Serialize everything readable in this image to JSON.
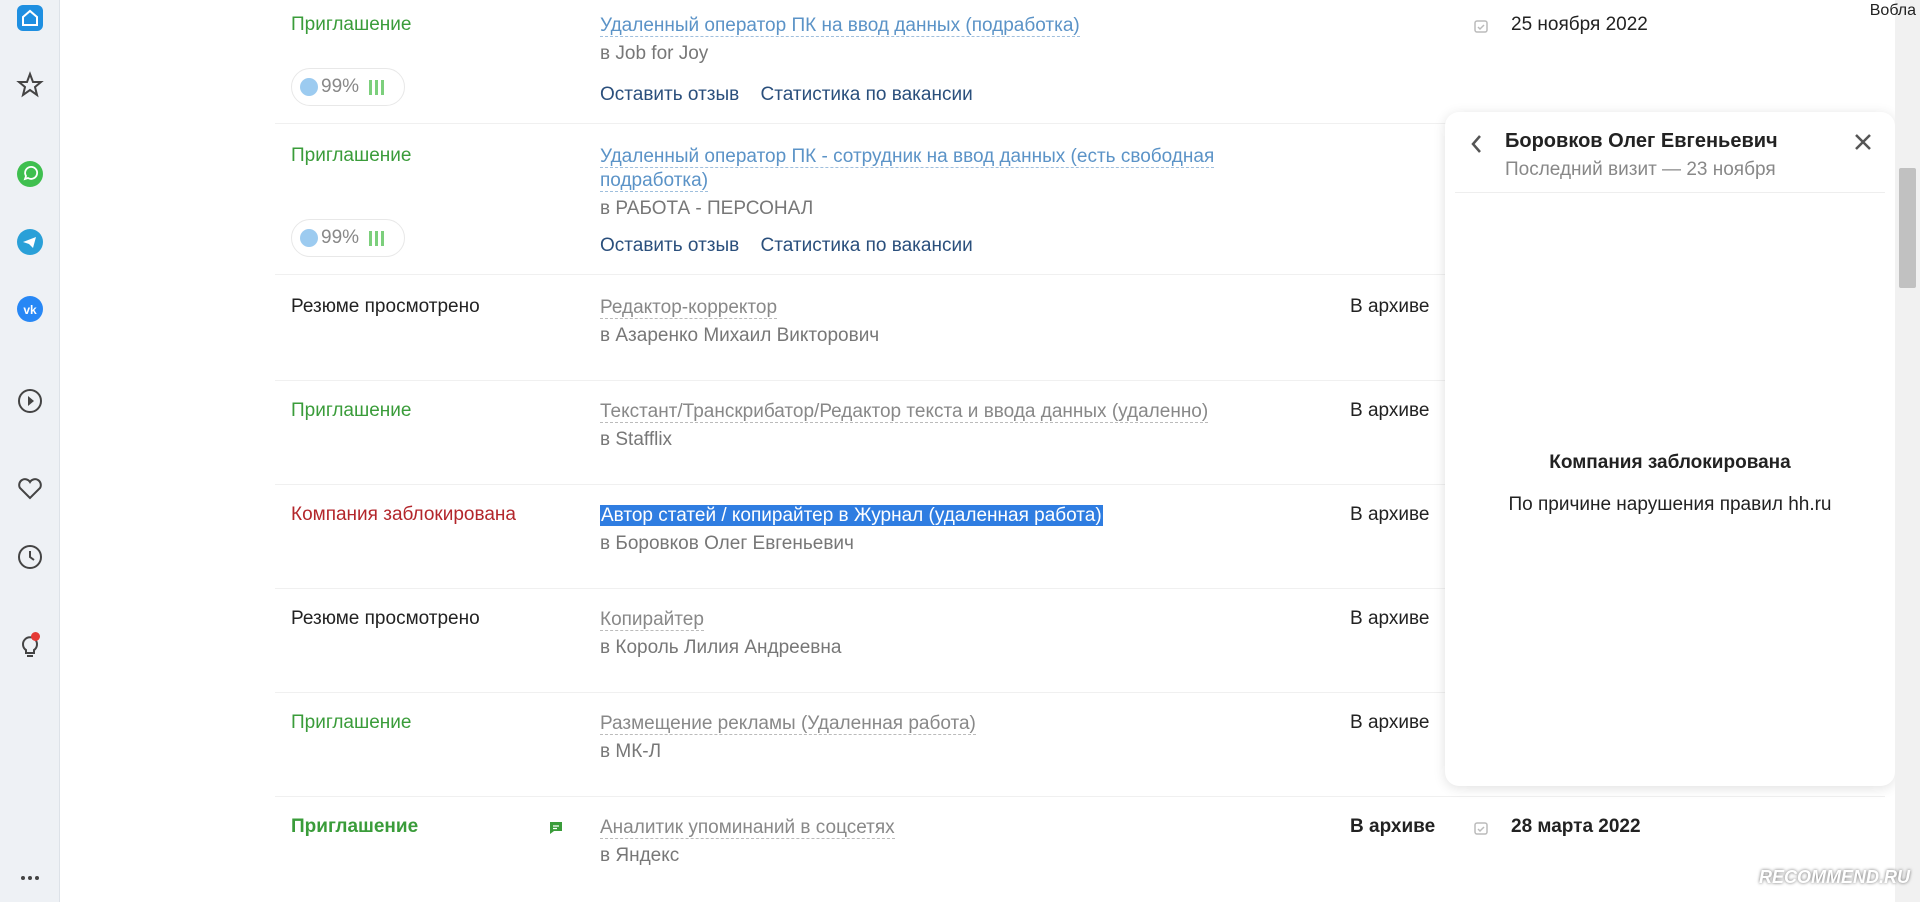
{
  "top_right_label": "Вобла",
  "sidebar": {
    "icons": [
      "home-icon",
      "star-icon",
      "whatsapp-icon",
      "telegram-icon",
      "vk-icon",
      "play-icon",
      "heart-icon",
      "clock-icon",
      "lightbulb-icon",
      "more-icon"
    ],
    "accent": "#1e8fe1"
  },
  "rows": [
    {
      "status": "Приглашение",
      "vacancy": "Удаленный оператор ПК на ввод данных (подработка)",
      "company": "в Job for Joy",
      "badge": "99%",
      "action_feedback": "Оставить отзыв",
      "action_stats": "Статистика по вакансии",
      "date": "25 ноября 2022"
    },
    {
      "status": "Приглашение",
      "vacancy": "Удаленный оператор ПК - сотрудник на ввод данных (есть свободная подработка)",
      "company": "в РАБОТА - ПЕРСОНАЛ",
      "badge": "99%",
      "action_feedback": "Оставить отзыв",
      "action_stats": "Статистика по вакансии"
    },
    {
      "status": "Резюме просмотрено",
      "vacancy": "Редактор-корректор",
      "company": "в Азаренко Михаил Викторович",
      "archive": "В архиве"
    },
    {
      "status": "Приглашение",
      "vacancy": "Текстант/Транскрибатор/Редактор текста и ввода данных (удаленно)",
      "company": "в Stafflix",
      "archive": "В архиве"
    },
    {
      "status": "Компания заблокирована",
      "vacancy": "Автор статей / копирайтер в Журнал (удаленная работа)",
      "company": "в Боровков Олег Евгеньевич",
      "archive": "В архиве"
    },
    {
      "status": "Резюме просмотрено",
      "vacancy": "Копирайтер",
      "company": "в Король Лилия Андреевна",
      "archive": "В архиве"
    },
    {
      "status": "Приглашение",
      "vacancy": "Размещение рекламы (Удаленная работа)",
      "company": "в МК-Л",
      "archive": "В архиве"
    },
    {
      "status": "Приглашение",
      "vacancy": "Аналитик упоминаний в соцсетях",
      "company": "в Яндекс",
      "archive": "В архиве",
      "date": "28 марта 2022"
    }
  ],
  "panel": {
    "name": "Боровков Олег Евгеньевич",
    "last_visit": "Последний визит — 23 ноября",
    "title": "Компания заблокирована",
    "text": "По причине нарушения правил hh.ru"
  },
  "watermark": "RECOMMEND.RU",
  "colors": {
    "status_green": "#3a9c3a",
    "status_red": "#b3262b",
    "link_blue": "#5b93c7",
    "selection": "#2f7de1"
  }
}
